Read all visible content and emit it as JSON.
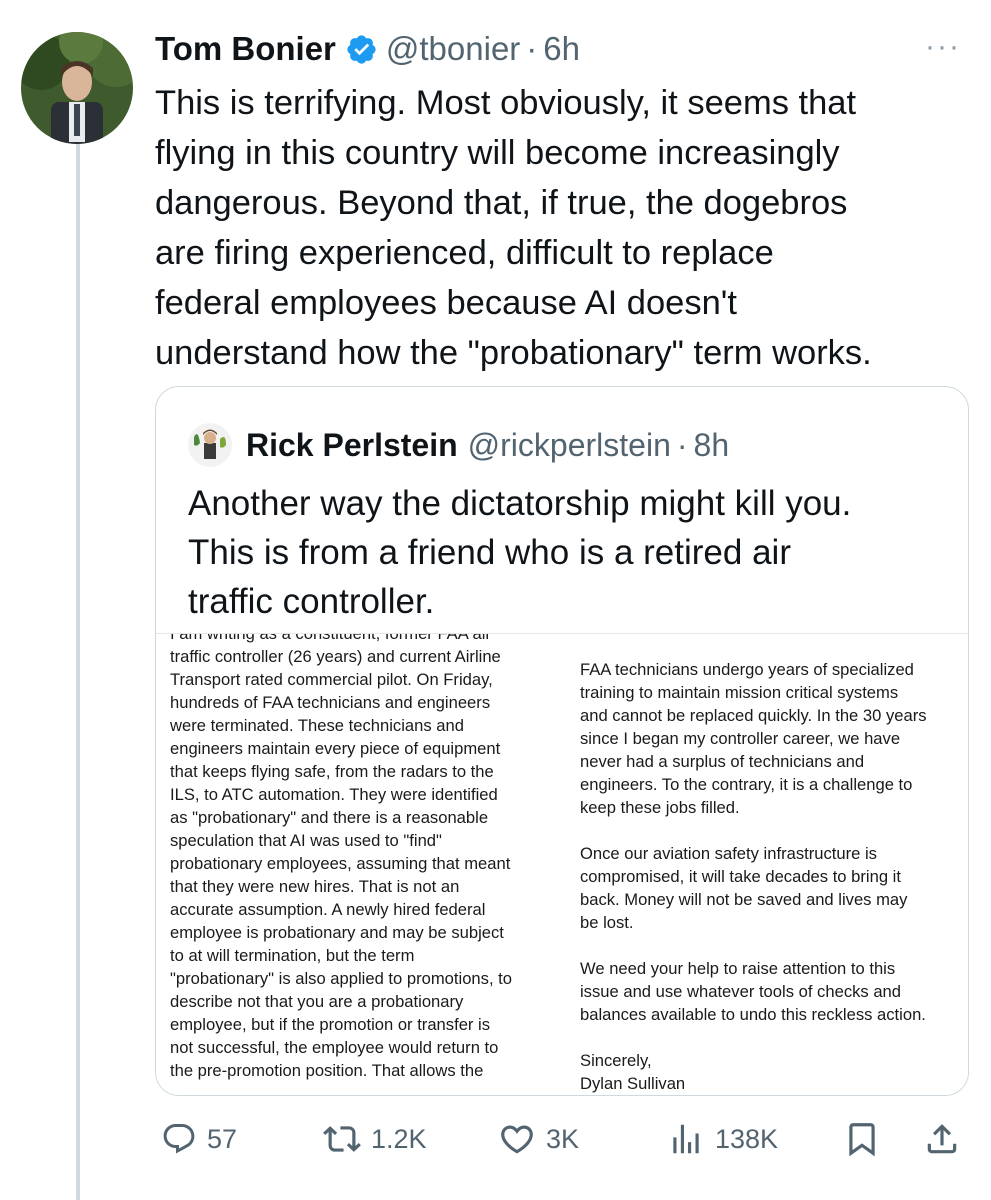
{
  "tweet": {
    "author_name": "Tom Bonier",
    "handle": "@tbonier",
    "separator": "·",
    "time": "6h",
    "more_label": "···",
    "text": "This is terrifying. Most obviously, it seems that\nflying in this country will become increasingly\ndangerous. Beyond that, if true, the dogebros\nare firing experienced, difficult to replace\nfederal employees because AI doesn't\nunderstand how the \"probationary\" term works."
  },
  "quoted": {
    "author_name": "Rick Perlstein",
    "handle": "@rickperlstein",
    "separator": "·",
    "time": "8h",
    "text": "Another way the dictatorship might kill you.\nThis is from a friend who is a retired air\ntraffic controller.",
    "letter": {
      "left_column": "I am writing as a constituent, former FAA air\ntraffic controller (26 years) and current Airline\nTransport rated commercial pilot.  On Friday,\nhundreds of FAA technicians and engineers\nwere terminated.  These technicians and\nengineers maintain every piece of equipment\nthat keeps flying safe, from the radars to the\nILS, to ATC automation.  They were identified\nas \"probationary\" and there is a reasonable\nspeculation that AI was used to \"find\"\nprobationary employees, assuming that meant\nthat they were new hires.  That is not an\naccurate assumption.  A newly hired federal\nemployee is probationary and may be subject\nto at will termination, but the term\n\"probationary\" is also applied to promotions, to\ndescribe not that you are a probationary\nemployee, but if the promotion or transfer is\nnot successful, the employee would return to\nthe pre-promotion position.  That allows the",
      "right_column": "FAA technicians undergo years of specialized\ntraining to maintain mission critical systems\nand cannot be replaced quickly.  In the 30 years\nsince I began my controller career, we have\nnever had a surplus of technicians and\nengineers.  To the contrary, it is a challenge to\nkeep these jobs filled.\n\nOnce our aviation safety infrastructure is\ncompromised, it will take decades to bring it\nback.  Money will not be saved and lives may\nbe lost.\n\nWe need your help to raise attention to this\nissue and use whatever tools of checks and\nbalances available to undo this reckless action.\n\nSincerely,\nDylan Sullivan"
    }
  },
  "actions": {
    "replies": "57",
    "reposts": "1.2K",
    "likes": "3K",
    "views": "138K"
  },
  "colors": {
    "verified_blue": "#1d9bf0",
    "secondary_text": "#536471",
    "border": "#cfd9de"
  },
  "icons": [
    "verified-badge-icon",
    "more-icon",
    "reply-icon",
    "repost-icon",
    "like-icon",
    "views-icon",
    "bookmark-icon",
    "share-icon"
  ]
}
